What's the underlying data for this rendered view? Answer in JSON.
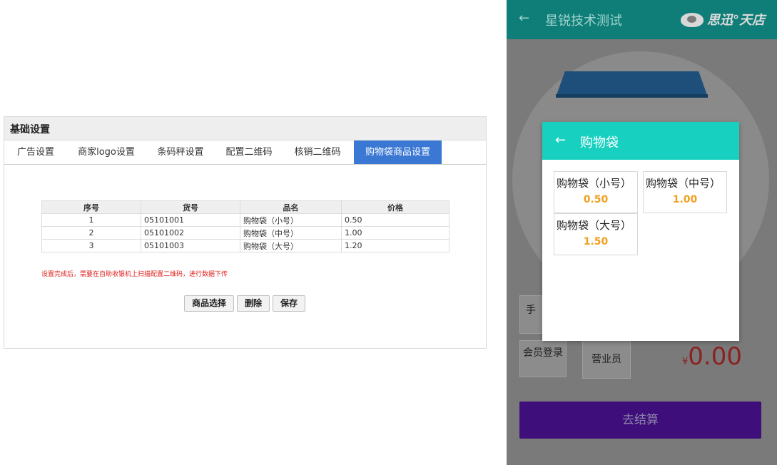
{
  "admin": {
    "title": "基础设置",
    "tabs": [
      {
        "label": "广告设置"
      },
      {
        "label": "商家logo设置"
      },
      {
        "label": "条码秤设置"
      },
      {
        "label": "配置二维码"
      },
      {
        "label": "核销二维码"
      },
      {
        "label": "购物袋商品设置"
      }
    ],
    "active_tab": "购物袋商品设置",
    "table": {
      "headers": [
        "序号",
        "货号",
        "品名",
        "价格"
      ],
      "rows": [
        [
          "1",
          "05101001",
          "购物袋（小号）",
          "0.50"
        ],
        [
          "2",
          "05101002",
          "购物袋（中号）",
          "1.00"
        ],
        [
          "3",
          "05101003",
          "购物袋（大号）",
          "1.20"
        ]
      ]
    },
    "note": "设置完成后，需要在自助收银机上扫描配置二维码，进行数据下传",
    "buttons": {
      "select": "商品选择",
      "delete": "删除",
      "save": "保存"
    }
  },
  "phone": {
    "back_glyph": "←",
    "store_title": "星锐技术测试",
    "logo_text": "思迅°天店",
    "buttons": {
      "manual": "手",
      "member_login": "会员登录",
      "clerk": "营业员",
      "checkout": "去结算"
    },
    "currency_symbol": "¥",
    "amount": "0.00",
    "dialog": {
      "back_glyph": "←",
      "title": "购物袋",
      "items": [
        {
          "name": "购物袋（小号）",
          "price": "0.50"
        },
        {
          "name": "购物袋（中号）",
          "price": "1.00"
        },
        {
          "name": "购物袋（大号）",
          "price": "1.50"
        }
      ]
    },
    "colors": {
      "header": "#0f7e78",
      "dialog_header": "#17d0bf",
      "price": "#f0a020",
      "checkout": "#3e0f7a",
      "amount": "#8a2222"
    }
  }
}
